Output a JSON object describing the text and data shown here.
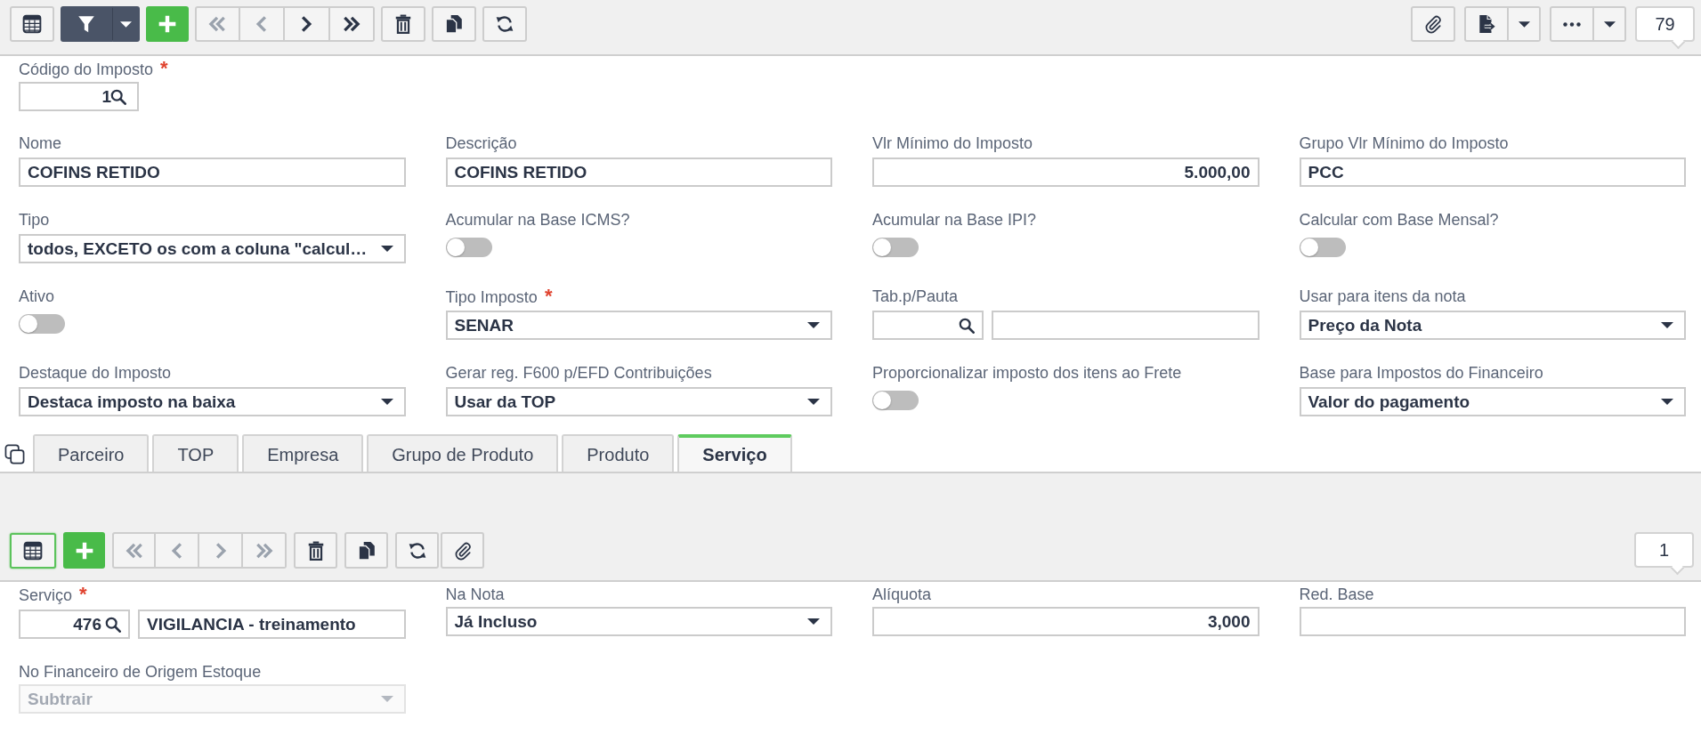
{
  "toolbar": {
    "navigation": [
      {
        "disabled": true
      },
      {
        "disabled": true
      },
      {
        "disabled": false
      },
      {
        "disabled": false
      }
    ],
    "record_counter": "79"
  },
  "header_field": {
    "label": "Código do Imposto",
    "required_mark": "*",
    "search_prefix": "1"
  },
  "form": {
    "fields": [
      {
        "kind": "text",
        "label": "Nome",
        "value": "COFINS RETIDO"
      },
      {
        "kind": "text",
        "label": "Descrição",
        "value": "COFINS RETIDO"
      },
      {
        "kind": "number",
        "label": "Vlr Mínimo do Imposto",
        "value": "5.000,00"
      },
      {
        "kind": "text",
        "label": "Grupo Vlr Mínimo do Imposto",
        "value": "PCC"
      },
      {
        "kind": "select",
        "label": "Tipo",
        "value": "todos, EXCETO os com a coluna \"calcul…"
      },
      {
        "kind": "toggle",
        "label": "Acumular na Base ICMS?",
        "on": false
      },
      {
        "kind": "toggle",
        "label": "Acumular na Base IPI?",
        "on": false
      },
      {
        "kind": "toggle",
        "label": "Calcular com Base Mensal?",
        "on": false
      },
      {
        "kind": "toggle",
        "label": "Ativo",
        "on": false
      },
      {
        "kind": "select",
        "label": "Tipo Imposto",
        "required_mark": "*",
        "value": "SENAR"
      },
      {
        "kind": "lookup",
        "label": "Tab.p/Pauta"
      },
      {
        "kind": "select",
        "label": "Usar para itens da nota",
        "value": "Preço da Nota"
      },
      {
        "kind": "select",
        "label": "Destaque do Imposto",
        "value": "Destaca imposto na baixa"
      },
      {
        "kind": "select",
        "label": "Gerar reg. F600 p/EFD Contribuições",
        "value": "Usar da TOP"
      },
      {
        "kind": "toggle",
        "label": "Proporcionalizar imposto dos itens ao Frete",
        "on": false
      },
      {
        "kind": "select",
        "label": "Base para Impostos do Financeiro",
        "value": "Valor do pagamento"
      }
    ]
  },
  "tabs": [
    {
      "label": "Parceiro",
      "selected": false
    },
    {
      "label": "TOP",
      "selected": false
    },
    {
      "label": "Empresa",
      "selected": false
    },
    {
      "label": "Grupo de Produto",
      "selected": false
    },
    {
      "label": "Produto",
      "selected": false
    },
    {
      "label": "Serviço",
      "selected": true
    }
  ],
  "sub_toolbar": {
    "grid_focused": true,
    "navigation": [
      {
        "disabled": true
      },
      {
        "disabled": true
      },
      {
        "disabled": true
      },
      {
        "disabled": true
      }
    ],
    "record_counter": "1"
  },
  "sub_form": {
    "fields": [
      {
        "kind": "lookup",
        "label": "Serviço",
        "required_mark": "*",
        "code": "476",
        "description": "VIGILANCIA - treinamento",
        "disabled": false
      },
      {
        "kind": "select",
        "label": "Na Nota",
        "value": "Já Incluso",
        "disabled": false
      },
      {
        "kind": "number",
        "label": "Alíquota",
        "value": "3,000",
        "disabled": false
      },
      {
        "kind": "text",
        "label": "Red. Base",
        "disabled": false
      },
      {
        "kind": "select",
        "label": "No Financeiro de Origem Estoque",
        "value": "Subtrair",
        "disabled": true
      }
    ]
  }
}
